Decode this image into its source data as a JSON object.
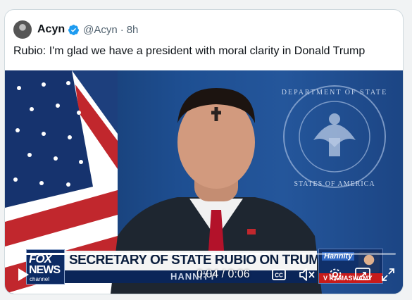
{
  "tweet": {
    "author_name": "Acyn",
    "handle": "@Acyn",
    "separator": "·",
    "time_ago": "8h",
    "text": "Rubio: I'm glad we have a president with moral clarity in Donald Trump"
  },
  "video": {
    "chyron": {
      "logo_line1": "FOX",
      "logo_line2": "NEWS",
      "logo_line3": "channel",
      "headline": "SECRETARY OF STATE RUBIO ON TRUMP'S SPEECH",
      "subline": "HANNITY"
    },
    "promo": {
      "title": "Hannity",
      "bottom": "V  RAMASWAMY"
    },
    "seal_text": "DEPARTMENT OF STATE · UNITED STATES OF AMERICA",
    "player": {
      "current_time": "0:04",
      "duration": "0:06",
      "time_display": "0:04 / 0:06",
      "progress_fraction": 0.667
    },
    "icons": [
      "play-icon",
      "captions-icon",
      "volume-muted-icon",
      "settings-icon",
      "picture-in-picture-icon",
      "fullscreen-icon"
    ]
  },
  "colors": {
    "verified": "#1d9bf0",
    "text": "#0f1419",
    "secondary_text": "#536471"
  }
}
